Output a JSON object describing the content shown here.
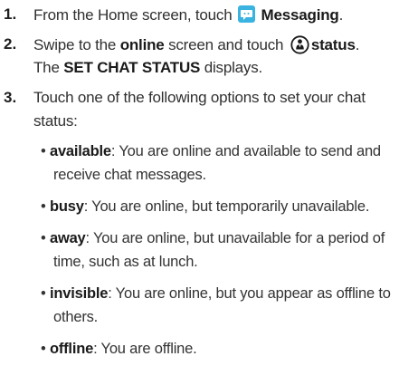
{
  "steps": [
    {
      "number": "1.",
      "parts": {
        "pre": "From the Home screen, touch ",
        "target": "Messaging",
        "post": "."
      },
      "icon": "messaging-app-icon"
    },
    {
      "number": "2.",
      "line1": {
        "pre": "Swipe to the ",
        "screen": "online",
        "mid": " screen and touch ",
        "target": "status",
        "post": "."
      },
      "line2": {
        "pre": "The ",
        "target": "SET CHAT STATUS",
        "post": " displays."
      },
      "icon": "person-status-icon"
    },
    {
      "number": "3.",
      "line1": "Touch one of the following options to set your chat",
      "line2": "status:"
    }
  ],
  "options": [
    {
      "bullet": "•",
      "term": "available",
      "desc": ": You are online and available to send and",
      "cont": "receive chat messages."
    },
    {
      "bullet": "•",
      "term": "busy",
      "desc": ": You are online, but temporarily unavailable.",
      "cont": ""
    },
    {
      "bullet": "•",
      "term": "away",
      "desc": ": You are online, but unavailable for a period of",
      "cont": "time, such as at lunch."
    },
    {
      "bullet": "•",
      "term": "invisible",
      "desc": ": You are online, but you appear as offline to",
      "cont": "others."
    },
    {
      "bullet": "•",
      "term": "offline",
      "desc": ": You are offline.",
      "cont": ""
    }
  ],
  "colors": {
    "icon_blue": "#3bb3e0",
    "text": "#2a2a2a"
  }
}
